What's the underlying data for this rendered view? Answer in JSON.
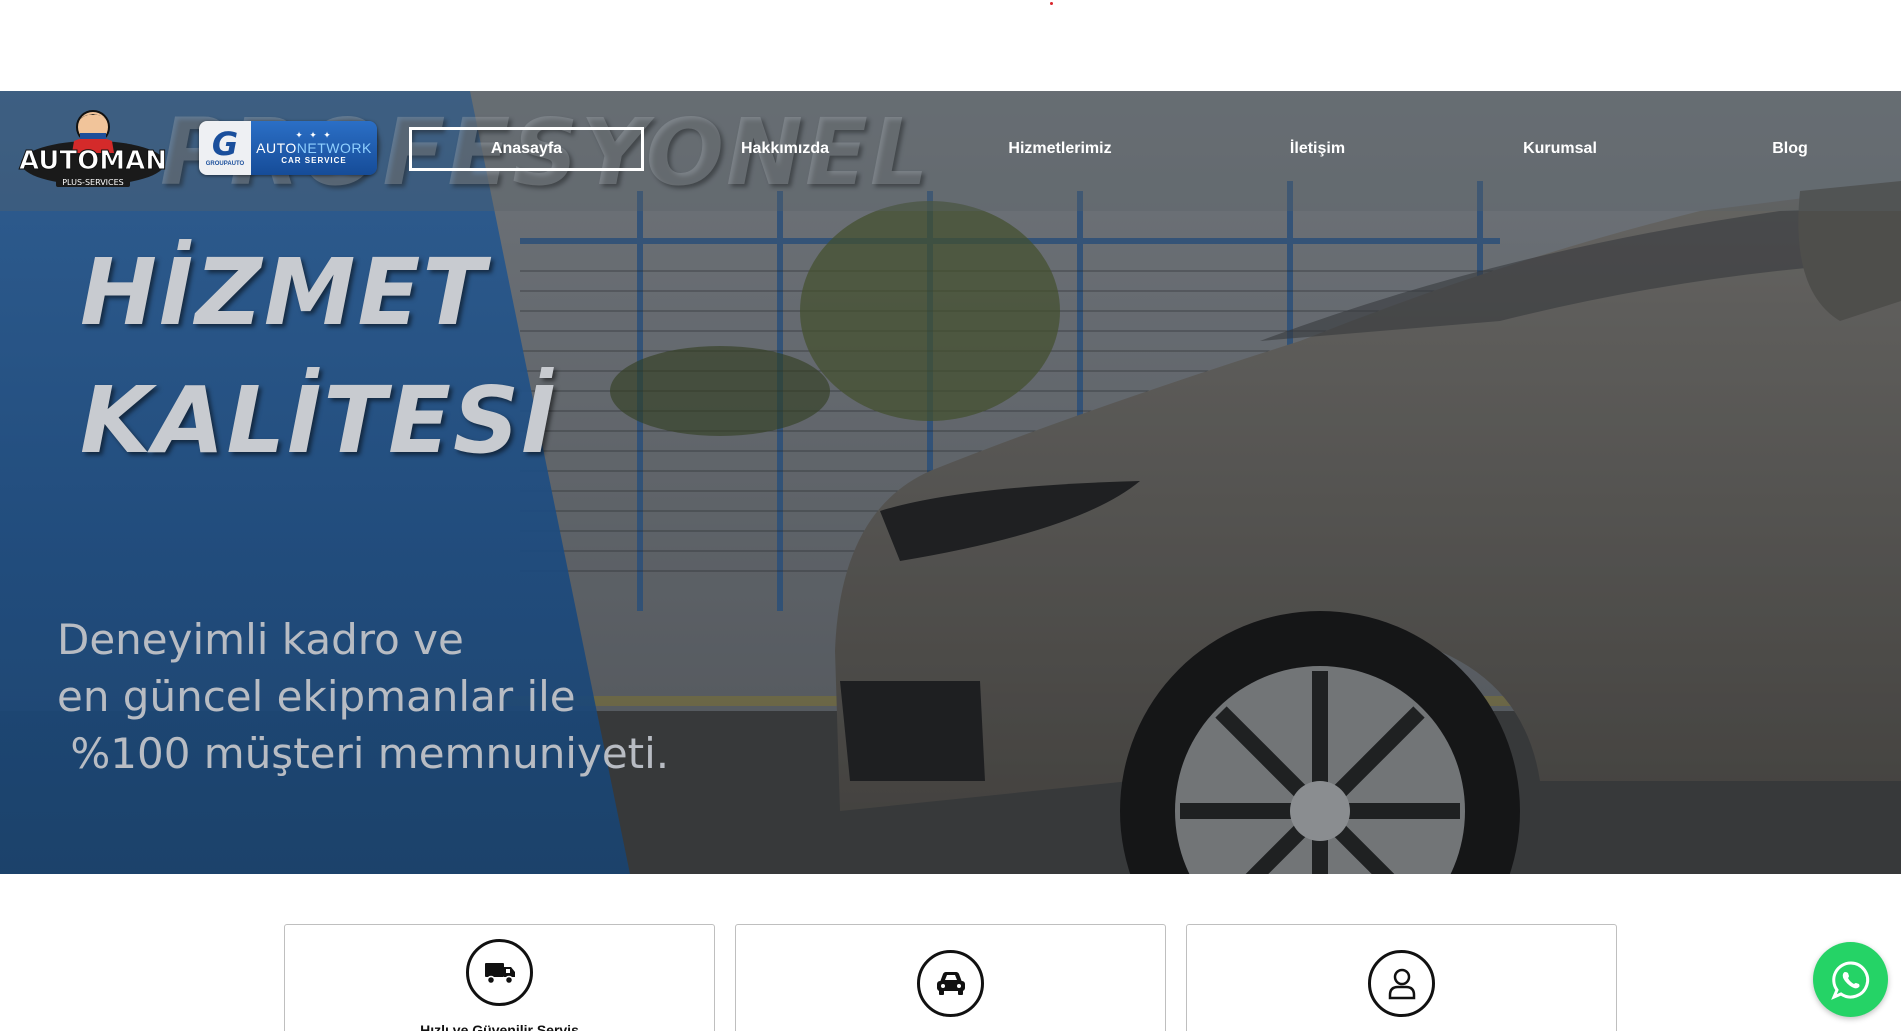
{
  "nav": {
    "items": [
      {
        "label": "Anasayfa",
        "active": true
      },
      {
        "label": "Hakkımızda",
        "active": false
      },
      {
        "label": "Hizmetlerimiz",
        "active": false
      },
      {
        "label": "İletişim",
        "active": false
      },
      {
        "label": "Kurumsal",
        "active": false
      },
      {
        "label": "Blog",
        "active": false
      }
    ]
  },
  "logos": {
    "automan": {
      "name": "AUTOMAN",
      "tagline": "PLUS-SERVICES"
    },
    "groupauto": {
      "mark": "G",
      "small": "GROUPAUTO",
      "name_a": "AUTO",
      "name_b": "NETWORK",
      "sub": "CAR SERVICE"
    }
  },
  "hero": {
    "ghost_text": "PROFESYONEL",
    "headline_line1": "HİZMET",
    "headline_line2": "KALİTESİ",
    "sub_line1": "Deneyimli kadro ve",
    "sub_line2": "en güncel ekipmanlar ile",
    "sub_line3": " %100 müşteri memnuniyeti."
  },
  "features": [
    {
      "title": "Hızlı ve Güvenilir Servis",
      "icon": "truck-icon"
    },
    {
      "title": "",
      "icon": "car-icon"
    },
    {
      "title": "",
      "icon": "user-icon"
    }
  ],
  "colors": {
    "brand_blue": "#1c4a7e",
    "whatsapp_green": "#25d366",
    "loader_red": "#d9262c"
  }
}
